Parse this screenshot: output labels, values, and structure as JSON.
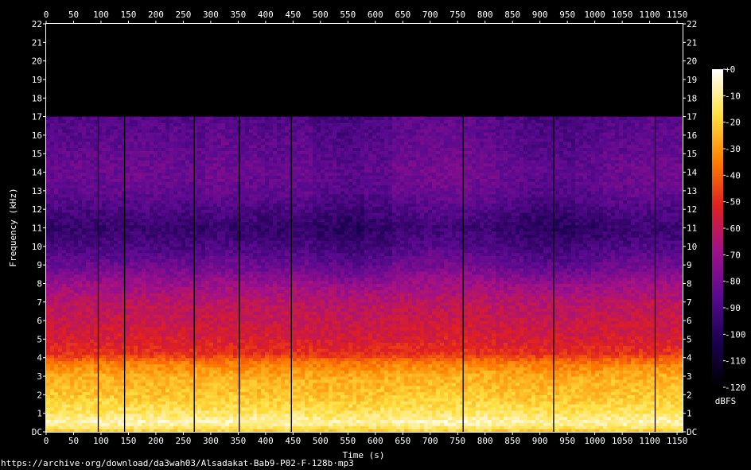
{
  "chart_data": {
    "type": "heatmap",
    "title": "",
    "xlabel": "Time (s)",
    "ylabel": "Frequency (kHz)",
    "xlim": [
      0,
      1160
    ],
    "ylim": [
      0,
      22
    ],
    "x_ticks": [
      "0",
      "50",
      "100",
      "150",
      "200",
      "250",
      "300",
      "350",
      "400",
      "450",
      "500",
      "550",
      "600",
      "650",
      "700",
      "750",
      "800",
      "850",
      "900",
      "950",
      "1000",
      "1050",
      "1100",
      "1150"
    ],
    "x_tick_values": [
      0,
      50,
      100,
      150,
      200,
      250,
      300,
      350,
      400,
      450,
      500,
      550,
      600,
      650,
      700,
      750,
      800,
      850,
      900,
      950,
      1000,
      1050,
      1100,
      1150
    ],
    "y_ticks": [
      "DC",
      "1",
      "2",
      "3",
      "4",
      "5",
      "6",
      "7",
      "8",
      "9",
      "10",
      "11",
      "12",
      "13",
      "14",
      "15",
      "16",
      "17",
      "18",
      "19",
      "20",
      "21",
      "22"
    ],
    "y_tick_values": [
      0,
      1,
      2,
      3,
      4,
      5,
      6,
      7,
      8,
      9,
      10,
      11,
      12,
      13,
      14,
      15,
      16,
      17,
      18,
      19,
      20,
      21,
      22
    ],
    "colorbar": {
      "label": "dBFS",
      "min": -120,
      "max": 0,
      "ticks": [
        "+0",
        "-10",
        "-20",
        "-30",
        "-40",
        "-50",
        "-60",
        "-70",
        "-80",
        "-90",
        "-100",
        "-110",
        "-120"
      ],
      "tick_values": [
        0,
        -10,
        -20,
        -30,
        -40,
        -50,
        -60,
        -70,
        -80,
        -90,
        -100,
        -110,
        -120
      ]
    },
    "lowpass_cutoff_khz": 17,
    "time_levels_db": [
      -92,
      -91,
      -90,
      -89,
      -90,
      -91,
      -88,
      -90,
      -92,
      -90,
      -95,
      -98,
      -94,
      -88,
      -86,
      -85,
      -88,
      -92,
      -96,
      -97,
      -94,
      -90,
      -88,
      -89
    ],
    "freq_profile": [
      {
        "khz": 0,
        "db": -22
      },
      {
        "khz": 0.5,
        "db": -6
      },
      {
        "khz": 1,
        "db": -14
      },
      {
        "khz": 2,
        "db": -22
      },
      {
        "khz": 3,
        "db": -26
      },
      {
        "khz": 3.8,
        "db": -36
      },
      {
        "khz": 4.2,
        "db": -48
      },
      {
        "khz": 5,
        "db": -54
      },
      {
        "khz": 6,
        "db": -58
      },
      {
        "khz": 7,
        "db": -62
      },
      {
        "khz": 8,
        "db": -70
      },
      {
        "khz": 8.8,
        "db": -80
      },
      {
        "khz": 10,
        "db": -90
      },
      {
        "khz": 11,
        "db": -96
      },
      {
        "khz": 12,
        "db": -90
      },
      {
        "khz": 13,
        "db": -84
      },
      {
        "khz": 14,
        "db": -82
      },
      {
        "khz": 15,
        "db": -84
      },
      {
        "khz": 16,
        "db": -86
      },
      {
        "khz": 17,
        "db": -88
      }
    ],
    "dropouts_s": [
      95,
      143,
      270,
      352,
      447,
      760,
      925,
      1110
    ],
    "grid": false,
    "colormap": [
      "#000000",
      "#1a0050",
      "#5a0a90",
      "#a0108a",
      "#e02020",
      "#ff8000",
      "#ffe040",
      "#ffffff"
    ]
  },
  "footer": {
    "source_url": "https://archive·org/download/da3wah03/Alsadakat-Bab9-P02-F-128b·mp3"
  }
}
